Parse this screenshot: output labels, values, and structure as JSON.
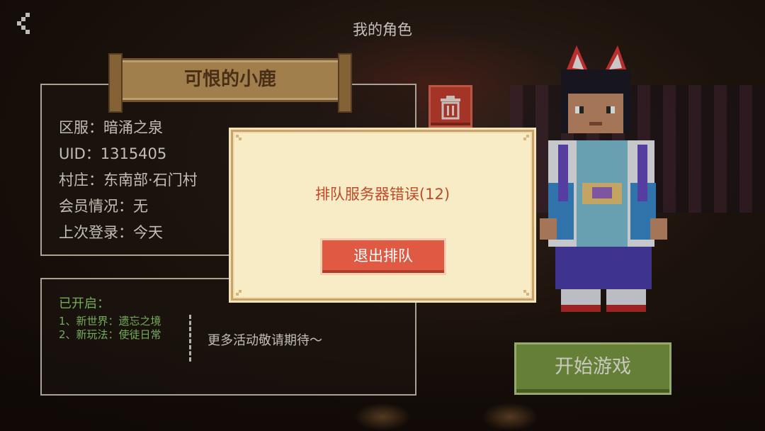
{
  "header": {
    "title": "我的角色",
    "back_icon": "back-arrow-icon"
  },
  "character": {
    "name": "可恨的小鹿",
    "server_label": "区服：",
    "server": "暗涌之泉",
    "uid_label": "UID：",
    "uid": "1315405",
    "village_label": "村庄：",
    "village": "东南部·石门村",
    "membership_label": "会员情况：",
    "membership": "无",
    "last_login_label": "上次登录：",
    "last_login": "今天"
  },
  "delete_button": {
    "icon": "trash-icon"
  },
  "activities": {
    "title": "已开启：",
    "items": [
      "1、新世界：遗忘之境",
      "2、新玩法：使徒日常"
    ],
    "more": "更多活动敬请期待～"
  },
  "start_button": {
    "label": "开始游戏"
  },
  "dialog": {
    "message": "排队服务器错误(12)",
    "exit_label": "退出排队"
  },
  "colors": {
    "dialog_bg": "#f8ecc6",
    "message": "#c04a2a",
    "exit_button": "#e05a43",
    "start_button": "#7c9b42",
    "delete_button": "#c9412f",
    "activity_text": "#8fd36a"
  }
}
